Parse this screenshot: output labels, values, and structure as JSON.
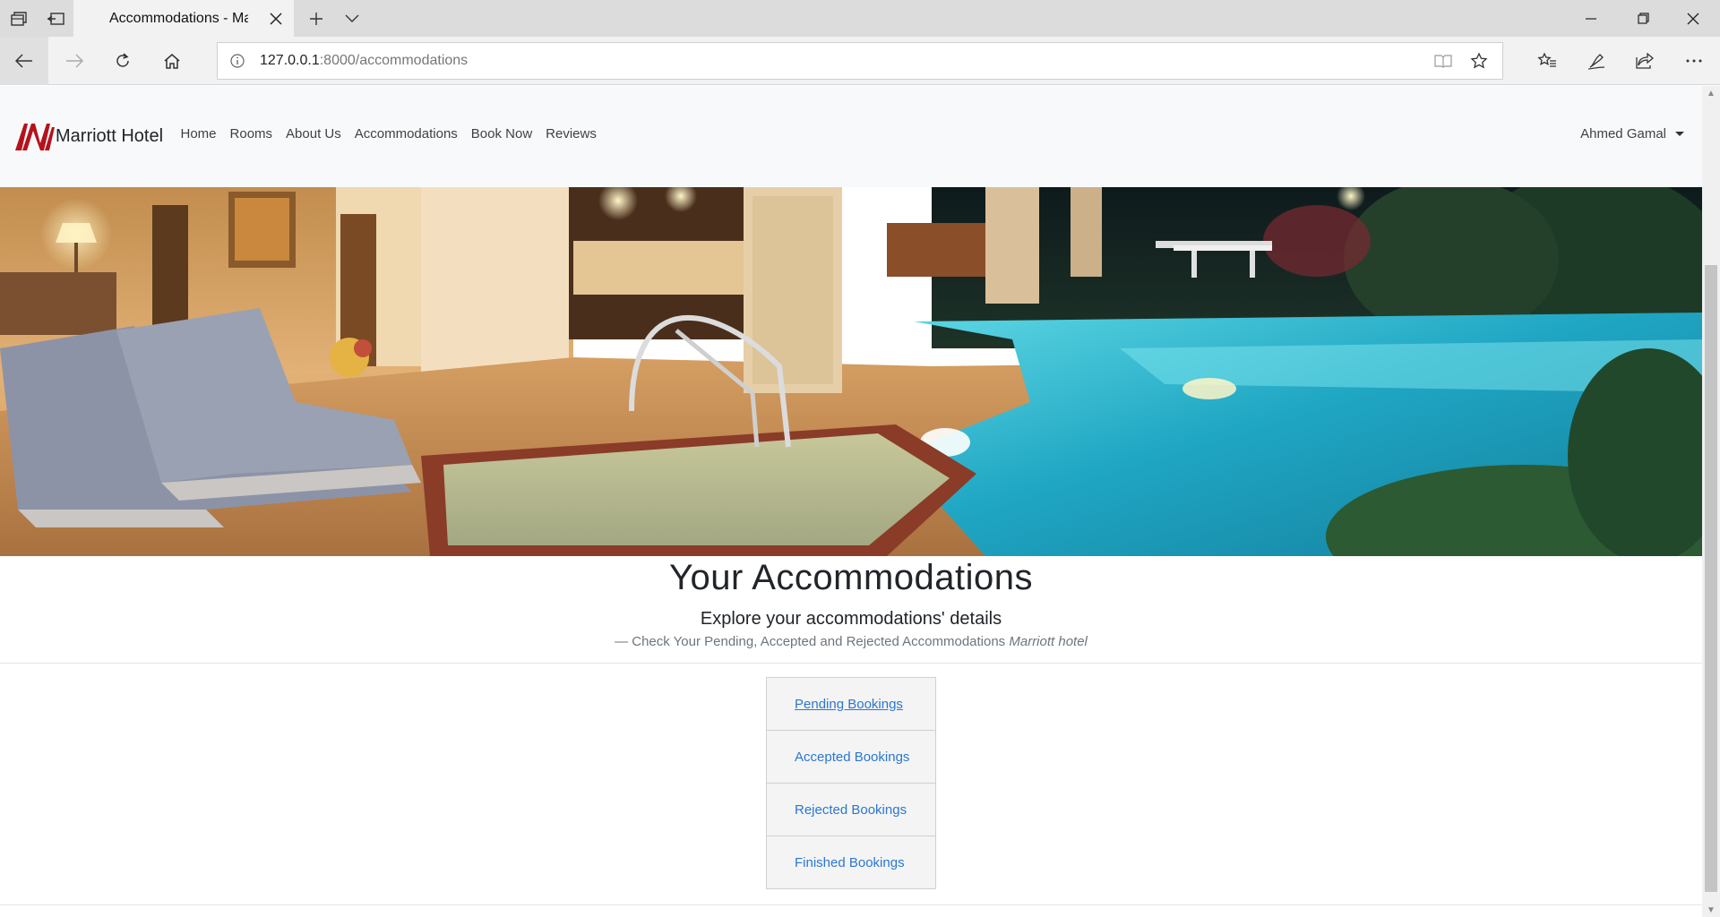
{
  "browser": {
    "tab_title": "Accommodations - Mar",
    "url_host": "127.0.0.1",
    "url_rest": ":8000/accommodations",
    "icons": [
      "tab-set-aside-icon",
      "tab-restore-icon",
      "new-tab-icon",
      "tab-list-icon",
      "minimize-icon",
      "maximize-icon",
      "close-window-icon",
      "back-icon",
      "forward-icon",
      "refresh-icon",
      "home-icon",
      "site-info-icon",
      "reading-view-icon",
      "favorite-star-icon",
      "favorites-hub-icon",
      "pen-icon",
      "share-icon",
      "more-icon"
    ]
  },
  "site": {
    "brand": "Marriott Hotel",
    "brand_color": "#b5121b",
    "nav": [
      {
        "label": "Home"
      },
      {
        "label": "Rooms"
      },
      {
        "label": "About Us"
      },
      {
        "label": "Accommodations"
      },
      {
        "label": "Book Now"
      },
      {
        "label": "Reviews"
      }
    ],
    "user": "Ahmed Gamal"
  },
  "main": {
    "title": "Your Accommodations",
    "lead": "Explore your accommodations' details",
    "footer_text": "— Check Your Pending, Accepted and Rejected Accommodations",
    "footer_cite": "Marriott hotel",
    "bookings": [
      {
        "label": "Pending Bookings"
      },
      {
        "label": "Accepted Bookings"
      },
      {
        "label": "Rejected Bookings"
      },
      {
        "label": "Finished Bookings"
      }
    ],
    "link_color": "#2a77d1"
  }
}
